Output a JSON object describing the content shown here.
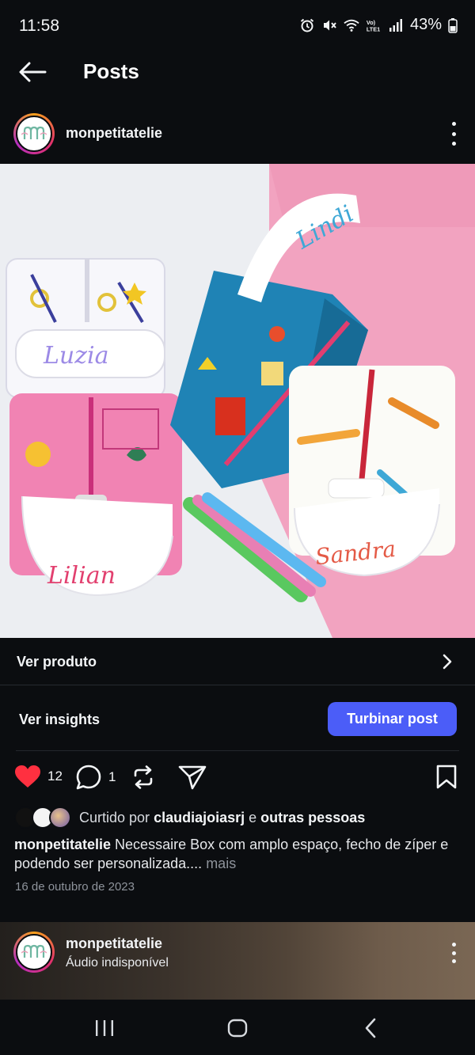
{
  "status_bar": {
    "time": "11:58",
    "battery": "43%",
    "icons": [
      "alarm-icon",
      "mute-icon",
      "wifi-icon",
      "volte-icon",
      "signal-icon",
      "battery-icon"
    ]
  },
  "header": {
    "title": "Posts",
    "back_icon": "arrow-left-icon"
  },
  "post": {
    "username": "monpetitatelie",
    "image_alt": "Necessaire box bags with names Luzia, Lindi, Lilian, Sandra",
    "bag_names": [
      "Luzia",
      "Lindi",
      "Lilian",
      "Sandra"
    ],
    "shop_label": "Ver produto",
    "insights_label": "Ver insights",
    "boost_label": "Turbinar post",
    "likes_count": "12",
    "comments_count": "1",
    "liked_by_prefix": "Curtido por",
    "liked_by_user": "claudiajoiasrj",
    "liked_by_and": "e",
    "liked_by_others": "outras pessoas",
    "caption_user": "monpetitatelie",
    "caption_text": "Necessaire Box com amplo espaço, fecho de zíper e podendo ser personalizada....",
    "caption_more": "mais",
    "date": "16 de outubro de 2023"
  },
  "next_post": {
    "username": "monpetitatelie",
    "audio": "Áudio indisponível"
  },
  "colors": {
    "background": "#0b0d10",
    "accent_blue": "#4b5df8",
    "like_red": "#ff3040"
  }
}
